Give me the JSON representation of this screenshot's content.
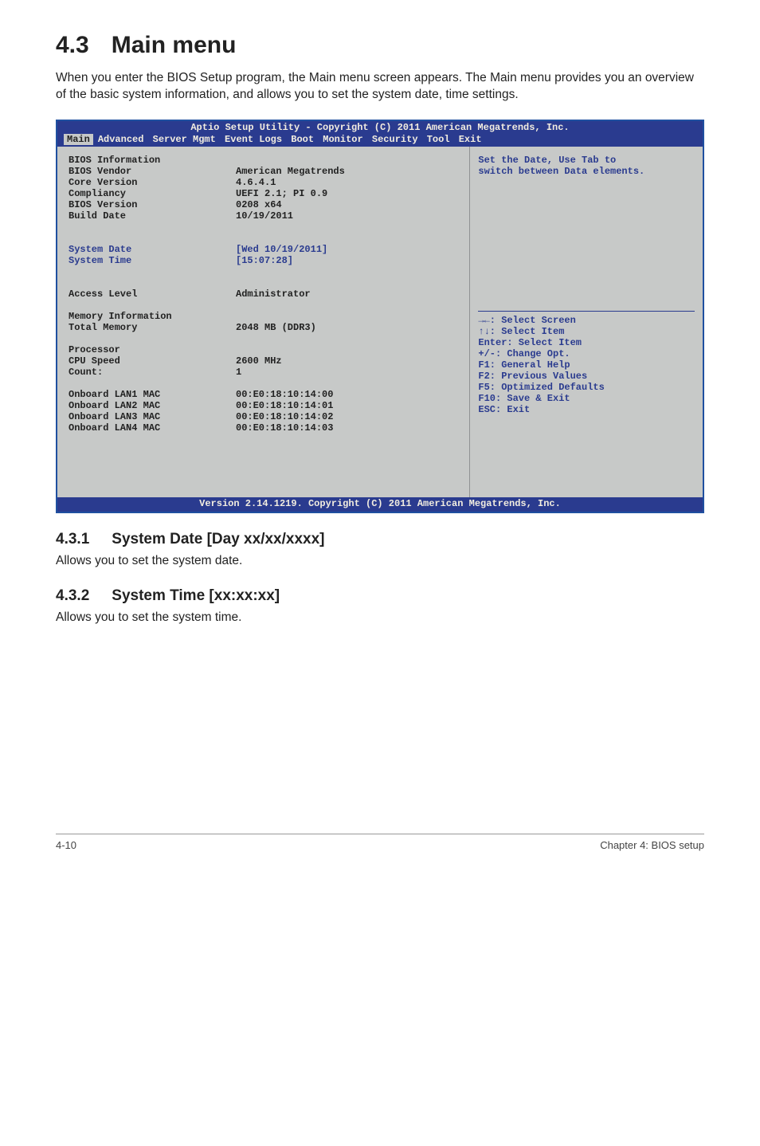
{
  "page": {
    "section_number": "4.3",
    "section_title": "Main menu",
    "intro": "When you enter the BIOS Setup program, the Main menu screen appears. The Main menu provides you an overview of the basic system information, and allows you to set the system date, time settings.",
    "footer_left": "4-10",
    "footer_right": "Chapter 4: BIOS setup"
  },
  "bios": {
    "title": "Aptio Setup Utility - Copyright (C) 2011 American Megatrends, Inc.",
    "tabs": {
      "active": "Main",
      "others": [
        "Advanced",
        "Server Mgmt",
        "Event Logs",
        "Boot",
        "Monitor",
        "Security",
        "Tool",
        "Exit"
      ]
    },
    "left": {
      "heading1": "BIOS Information",
      "rows1": {
        "bios_vendor_lbl": "BIOS Vendor",
        "bios_vendor_val": "American Megatrends",
        "core_version_lbl": "Core Version",
        "core_version_val": "4.6.4.1",
        "compliancy_lbl": "Compliancy",
        "compliancy_val": "UEFI 2.1; PI 0.9",
        "bios_version_lbl": "BIOS Version",
        "bios_version_val": "0208 x64",
        "build_date_lbl": "Build Date",
        "build_date_val": "10/19/2011"
      },
      "system_date_lbl": "System Date",
      "system_date_val": "[Wed 10/19/2011]",
      "system_time_lbl": "System Time",
      "system_time_val": "[15:07:28]",
      "access_level_lbl": "Access Level",
      "access_level_val": "Administrator",
      "mem_heading": "Memory Information",
      "total_memory_lbl": "Total Memory",
      "total_memory_val": "2048 MB (DDR3)",
      "processor_lbl": "Processor",
      "cpu_speed_lbl": "CPU Speed",
      "cpu_speed_val": "2600 MHz",
      "count_lbl": "Count:",
      "count_val": "1",
      "lan1_lbl": "Onboard LAN1 MAC",
      "lan1_val": "00:E0:18:10:14:00",
      "lan2_lbl": "Onboard LAN2 MAC",
      "lan2_val": "00:E0:18:10:14:01",
      "lan3_lbl": "Onboard LAN3 MAC",
      "lan3_val": "00:E0:18:10:14:02",
      "lan4_lbl": "Onboard LAN4 MAC",
      "lan4_val": "00:E0:18:10:14:03"
    },
    "right": {
      "help1": "Set the Date, Use Tab to",
      "help2": "switch between Data elements.",
      "nav": {
        "l1": "→←: Select Screen",
        "l2": "↑↓: Select Item",
        "l3": "Enter: Select Item",
        "l4": "+/-: Change Opt.",
        "l5": "F1: General Help",
        "l6": "F2: Previous Values",
        "l7": "F5: Optimized Defaults",
        "l8": "F10: Save & Exit",
        "l9": "ESC: Exit"
      }
    },
    "copyright": "Version 2.14.1219. Copyright (C) 2011 American Megatrends, Inc."
  },
  "subsections": {
    "s431_num": "4.3.1",
    "s431_title": "System Date [Day xx/xx/xxxx]",
    "s431_desc": "Allows you to set the system date.",
    "s432_num": "4.3.2",
    "s432_title": "System Time [xx:xx:xx]",
    "s432_desc": "Allows you to set the system time."
  }
}
